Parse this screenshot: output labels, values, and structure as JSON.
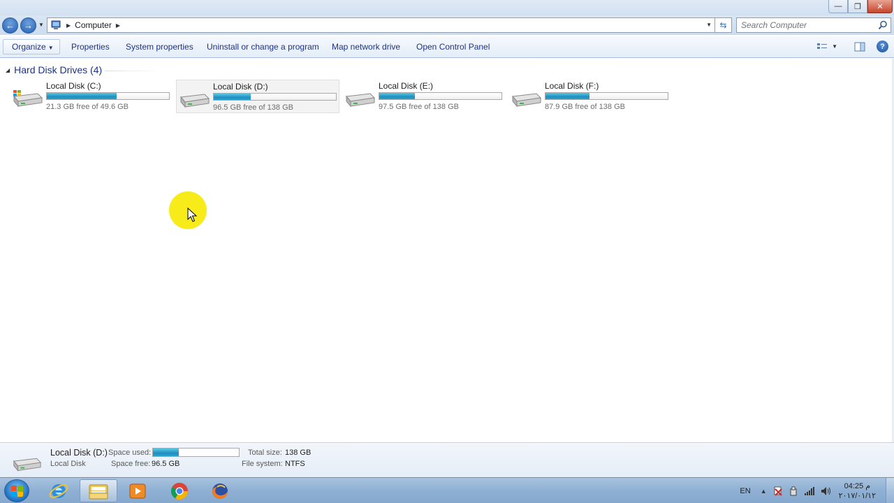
{
  "window": {
    "controls": {
      "minimize": "—",
      "maximize": "❐",
      "close": "✕"
    }
  },
  "nav": {
    "back_glyph": "←",
    "forward_glyph": "→",
    "breadcrumb": [
      "Computer"
    ],
    "search_placeholder": "Search Computer"
  },
  "toolbar": {
    "items": [
      {
        "label": "Organize",
        "has_dropdown": true
      },
      {
        "label": "Properties"
      },
      {
        "label": "System properties"
      },
      {
        "label": "Uninstall or change a program"
      },
      {
        "label": "Map network drive"
      },
      {
        "label": "Open Control Panel"
      }
    ],
    "help_glyph": "?"
  },
  "content": {
    "group_title": "Hard Disk Drives (4)",
    "drives": [
      {
        "name": "Local Disk (C:)",
        "free_text": "21.3 GB free of 49.6 GB",
        "used_fraction": 0.57,
        "selected": false
      },
      {
        "name": "Local Disk (D:)",
        "free_text": "96.5 GB free of 138 GB",
        "used_fraction": 0.3,
        "selected": true
      },
      {
        "name": "Local Disk (E:)",
        "free_text": "97.5 GB free of 138 GB",
        "used_fraction": 0.29,
        "selected": false
      },
      {
        "name": "Local Disk (F:)",
        "free_text": "87.9 GB free of 138 GB",
        "used_fraction": 0.36,
        "selected": false
      }
    ]
  },
  "details": {
    "name": "Local Disk (D:)",
    "type": "Local Disk",
    "space_used_label": "Space used:",
    "space_used_fraction": 0.3,
    "space_free_label": "Space free:",
    "space_free_value": "96.5 GB",
    "total_size_label": "Total size:",
    "total_size_value": "138 GB",
    "file_system_label": "File system:",
    "file_system_value": "NTFS"
  },
  "taskbar": {
    "apps": [
      "internet-explorer",
      "windows-explorer",
      "media-player",
      "chrome",
      "firefox"
    ],
    "language": "EN",
    "clock_time": "04:25 م",
    "clock_date": "٢٠١٧/٠١/١٢"
  },
  "colors": {
    "bar_fill": "#26a0da",
    "link_text": "#1e3287",
    "cursor_highlight": "#f7ec1a"
  }
}
